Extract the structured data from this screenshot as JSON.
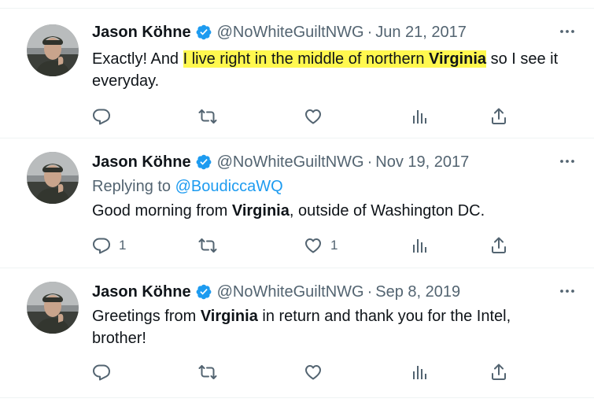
{
  "tweets": [
    {
      "author_name": "Jason Köhne",
      "handle": "@NoWhiteGuiltNWG",
      "separator": "·",
      "date": "Jun 21, 2017",
      "text_before": "Exactly! And ",
      "text_highlight_1": "I live right in the middle of northern ",
      "text_highlight_bold": "Virginia",
      "text_after": " so I see it everyday.",
      "reply_count": "",
      "like_count": ""
    },
    {
      "author_name": "Jason Köhne",
      "handle": "@NoWhiteGuiltNWG",
      "separator": "·",
      "date": "Nov 19, 2017",
      "replying_label": "Replying to ",
      "replying_to": "@BoudiccaWQ",
      "text_before": "Good morning from ",
      "text_bold": "Virginia",
      "text_after": ", outside of Washington DC.",
      "reply_count": "1",
      "like_count": "1"
    },
    {
      "author_name": "Jason Köhne",
      "handle": "@NoWhiteGuiltNWG",
      "separator": "·",
      "date": "Sep 8, 2019",
      "text_before": "Greetings from ",
      "text_bold": "Virginia",
      "text_after": " in return and thank you for the Intel, brother!",
      "reply_count": "",
      "like_count": ""
    }
  ],
  "colors": {
    "text": "#0f1419",
    "secondary": "#536471",
    "accent": "#1d9bf0",
    "highlight": "#fff84f",
    "divider": "#eff3f4"
  },
  "icons": {
    "more": "more-horizontal-icon",
    "reply": "reply-icon",
    "retweet": "retweet-icon",
    "like": "like-icon",
    "views": "views-icon",
    "share": "share-icon",
    "verified": "verified-badge-icon"
  }
}
